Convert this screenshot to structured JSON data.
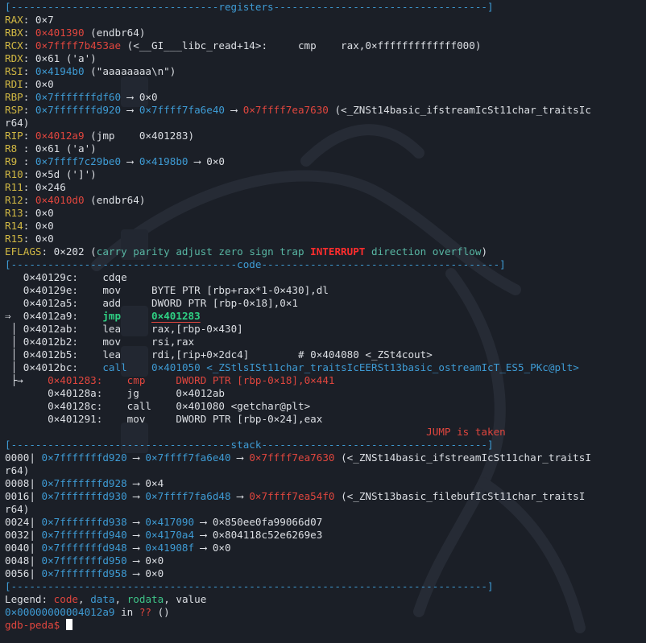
{
  "sections": {
    "registers": "registers",
    "code": "code",
    "stack": "stack"
  },
  "registers": [
    {
      "name": "RAX",
      "parts": [
        {
          "t": "0×7",
          "c": "white"
        }
      ]
    },
    {
      "name": "RBX",
      "parts": [
        {
          "t": "0×401390",
          "c": "red"
        },
        {
          "t": " (endbr64)",
          "c": "white"
        }
      ]
    },
    {
      "name": "RCX",
      "parts": [
        {
          "t": "0×7ffff7b453ae",
          "c": "red"
        },
        {
          "t": " (<__GI___libc_read+14>:     cmp    rax,0×fffffffffffff000)",
          "c": "white"
        }
      ]
    },
    {
      "name": "RDX",
      "parts": [
        {
          "t": "0×61 ('a')",
          "c": "white"
        }
      ]
    },
    {
      "name": "RSI",
      "parts": [
        {
          "t": "0×4194b0",
          "c": "blue"
        },
        {
          "t": " (\"aaaaaaaa\\n\")",
          "c": "white"
        }
      ]
    },
    {
      "name": "RDI",
      "parts": [
        {
          "t": "0×0",
          "c": "white"
        }
      ]
    },
    {
      "name": "RBP",
      "parts": [
        {
          "t": "0×7fffffffdf60",
          "c": "blue"
        },
        {
          "t": " ⟶ 0×0",
          "c": "white"
        }
      ]
    },
    {
      "name": "RSP",
      "parts": [
        {
          "t": "0×7fffffffd920",
          "c": "blue"
        },
        {
          "t": " ⟶ ",
          "c": "white"
        },
        {
          "t": "0×7ffff7fa6e40",
          "c": "blue"
        },
        {
          "t": " ⟶ ",
          "c": "white"
        },
        {
          "t": "0×7ffff7ea7630",
          "c": "red"
        },
        {
          "t": " (<_ZNSt14basic_ifstreamIcSt11char_traitsIc",
          "c": "white"
        }
      ]
    },
    {
      "name": "",
      "parts": [
        {
          "t": "r64)",
          "c": "white"
        }
      ]
    },
    {
      "name": "RIP",
      "parts": [
        {
          "t": "0×4012a9",
          "c": "red"
        },
        {
          "t": " (jmp    0×401283)",
          "c": "white"
        }
      ]
    },
    {
      "name": "R8 ",
      "parts": [
        {
          "t": "0×61 ('a')",
          "c": "white"
        }
      ]
    },
    {
      "name": "R9 ",
      "parts": [
        {
          "t": "0×7ffff7c29be0",
          "c": "blue"
        },
        {
          "t": " ⟶ ",
          "c": "white"
        },
        {
          "t": "0×4198b0",
          "c": "blue"
        },
        {
          "t": " ⟶ 0×0",
          "c": "white"
        }
      ]
    },
    {
      "name": "R10",
      "parts": [
        {
          "t": "0×5d (']')",
          "c": "white"
        }
      ]
    },
    {
      "name": "R11",
      "parts": [
        {
          "t": "0×246",
          "c": "white"
        }
      ]
    },
    {
      "name": "R12",
      "parts": [
        {
          "t": "0×4010d0",
          "c": "red"
        },
        {
          "t": " (endbr64)",
          "c": "white"
        }
      ]
    },
    {
      "name": "R13",
      "parts": [
        {
          "t": "0×0",
          "c": "white"
        }
      ]
    },
    {
      "name": "R14",
      "parts": [
        {
          "t": "0×0",
          "c": "white"
        }
      ]
    },
    {
      "name": "R15",
      "parts": [
        {
          "t": "0×0",
          "c": "white"
        }
      ]
    }
  ],
  "eflags": {
    "label": "EFLAGS",
    "value": "0×202",
    "open": " (",
    "flags_before": "carry parity adjust zero sign trap ",
    "interrupt": "INTERRUPT",
    "flags_after": " direction overflow",
    "close": ")"
  },
  "code": [
    {
      "prefix": "   ",
      "addr": "0×40129c:",
      "mn": "cdqe",
      "ops": "",
      "style": "normal"
    },
    {
      "prefix": "   ",
      "addr": "0×40129e:",
      "mn": "mov ",
      "ops": "BYTE PTR [rbp+rax*1-0×430],dl",
      "style": "normal"
    },
    {
      "prefix": "   ",
      "addr": "0×4012a5:",
      "mn": "add ",
      "ops": "DWORD PTR [rbp-0×18],0×1",
      "style": "normal"
    },
    {
      "prefix": "⇒  ",
      "addr": "0×4012a9:",
      "mn": "jmp ",
      "ops": "0×401283",
      "style": "current"
    },
    {
      "prefix": " │ ",
      "addr": "0×4012ab:",
      "mn": "lea ",
      "ops": "rax,[rbp-0×430]",
      "style": "normal"
    },
    {
      "prefix": " │ ",
      "addr": "0×4012b2:",
      "mn": "mov ",
      "ops": "rsi,rax",
      "style": "normal"
    },
    {
      "prefix": " │ ",
      "addr": "0×4012b5:",
      "mn": "lea ",
      "ops": "rdi,[rip+0×2dc4]        # 0×404080 <_ZSt4cout>",
      "style": "normal"
    },
    {
      "prefix": " │ ",
      "addr": "0×4012bc:",
      "mn": "call",
      "ops": "0×401050 <_ZStlsISt11char_traitsIcEERSt13basic_ostreamIcT_ES5_PKc@plt>",
      "style": "call"
    }
  ],
  "jump_target": [
    {
      "prefix": " ├→    ",
      "addr": "0×401283:",
      "mn": "cmp ",
      "ops": "DWORD PTR [rbp-0×18],0×441",
      "style": "target"
    },
    {
      "prefix": "       ",
      "addr": "0×40128a:",
      "mn": "jg  ",
      "ops": "0×4012ab",
      "style": "normal"
    },
    {
      "prefix": "       ",
      "addr": "0×40128c:",
      "mn": "call",
      "ops": "0×401080 <getchar@plt>",
      "style": "normal"
    },
    {
      "prefix": "       ",
      "addr": "0×401291:",
      "mn": "mov ",
      "ops": "DWORD PTR [rbp-0×24],eax",
      "style": "normal"
    }
  ],
  "jump_taken": "JUMP is taken",
  "stack": [
    {
      "off": "0000",
      "addr": "0×7fffffffd920",
      "rest": [
        {
          "t": " ⟶ ",
          "c": "white"
        },
        {
          "t": "0×7ffff7fa6e40",
          "c": "blue"
        },
        {
          "t": " ⟶ ",
          "c": "white"
        },
        {
          "t": "0×7ffff7ea7630",
          "c": "red"
        },
        {
          "t": " (<_ZNSt14basic_ifstreamIcSt11char_traitsI",
          "c": "white"
        }
      ]
    },
    {
      "off": "",
      "addr": "",
      "rest": [
        {
          "t": "r64)",
          "c": "white"
        }
      ]
    },
    {
      "off": "0008",
      "addr": "0×7fffffffd928",
      "rest": [
        {
          "t": " ⟶ 0×4",
          "c": "white"
        }
      ]
    },
    {
      "off": "0016",
      "addr": "0×7fffffffd930",
      "rest": [
        {
          "t": " ⟶ ",
          "c": "white"
        },
        {
          "t": "0×7ffff7fa6d48",
          "c": "blue"
        },
        {
          "t": " ⟶ ",
          "c": "white"
        },
        {
          "t": "0×7ffff7ea54f0",
          "c": "red"
        },
        {
          "t": " (<_ZNSt13basic_filebufIcSt11char_traitsI",
          "c": "white"
        }
      ]
    },
    {
      "off": "",
      "addr": "",
      "rest": [
        {
          "t": "r64)",
          "c": "white"
        }
      ]
    },
    {
      "off": "0024",
      "addr": "0×7fffffffd938",
      "rest": [
        {
          "t": " ⟶ ",
          "c": "white"
        },
        {
          "t": "0×417090",
          "c": "blue"
        },
        {
          "t": " ⟶ 0×850ee0fa99066d07",
          "c": "white"
        }
      ]
    },
    {
      "off": "0032",
      "addr": "0×7fffffffd940",
      "rest": [
        {
          "t": " ⟶ ",
          "c": "white"
        },
        {
          "t": "0×4170a4",
          "c": "blue"
        },
        {
          "t": " ⟶ 0×804118c52e6269e3",
          "c": "white"
        }
      ]
    },
    {
      "off": "0040",
      "addr": "0×7fffffffd948",
      "rest": [
        {
          "t": " ⟶ ",
          "c": "white"
        },
        {
          "t": "0×41908f",
          "c": "blue"
        },
        {
          "t": " ⟶ 0×0",
          "c": "white"
        }
      ]
    },
    {
      "off": "0048",
      "addr": "0×7fffffffd950",
      "rest": [
        {
          "t": " ⟶ 0×0",
          "c": "white"
        }
      ]
    },
    {
      "off": "0056",
      "addr": "0×7fffffffd958",
      "rest": [
        {
          "t": " ⟶ 0×0",
          "c": "white"
        }
      ]
    }
  ],
  "legend": {
    "label": "Legend: ",
    "code": "code",
    "data": "data",
    "rodata": "rodata",
    "value": "value",
    "sep": ", "
  },
  "location": {
    "addr": "0×00000000004012a9",
    "in": " in ",
    "func": "??",
    "args": " ()"
  },
  "prompt": "gdb-peda$ ",
  "colors": {
    "background": "#1b1f27",
    "blue": "#3e9bd4",
    "red": "#e0463e",
    "teal": "#58b6a3",
    "green": "#3ec488",
    "yellow": "#d2b944"
  }
}
